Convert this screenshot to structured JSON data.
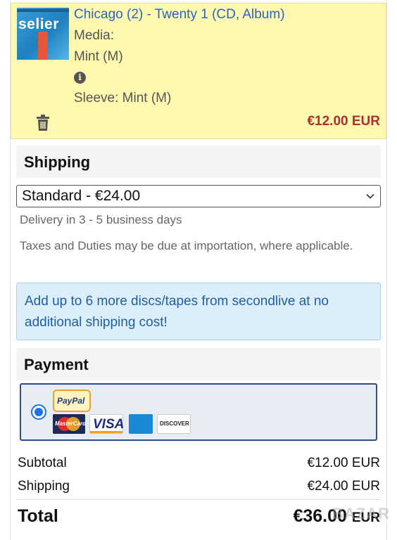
{
  "item": {
    "title": "Chicago (2) - Twenty 1 (CD, Album)",
    "thumbnail_text": "selier",
    "media_label": "Media:",
    "media_value": "Mint (M)",
    "sleeve": "Sleeve: Mint (M)",
    "price": "€12.00 EUR",
    "icons": {
      "info": "info-icon",
      "delete": "trash-icon"
    }
  },
  "shipping": {
    "heading": "Shipping",
    "selected_option": "Standard - €24.00",
    "delivery": "Delivery in 3 - 5 business days",
    "taxes": "Taxes and Duties may be due at importation, where applicable.",
    "promo": "Add up to 6 more discs/tapes from secondlive at no additional shipping cost!"
  },
  "payment": {
    "heading": "Payment",
    "methods": {
      "paypal": "PayPal",
      "mastercard": "MasterCard",
      "visa": "VISA",
      "discover": "DISCOVER"
    }
  },
  "summary": {
    "subtotal_label": "Subtotal",
    "subtotal_value": "€12.00 EUR",
    "shipping_label": "Shipping",
    "shipping_value": "€24.00 EUR",
    "total_label": "Total",
    "total_amount": "€36.00",
    "total_currency": "EUR"
  },
  "watermark": "BAZAR",
  "colors": {
    "item_bg": "#fff9b0",
    "link": "#2a63c6",
    "price": "#a8322d",
    "promo_bg": "#dbeefa",
    "promo_text": "#1f5fa0",
    "payment_border": "#2d4f82"
  }
}
